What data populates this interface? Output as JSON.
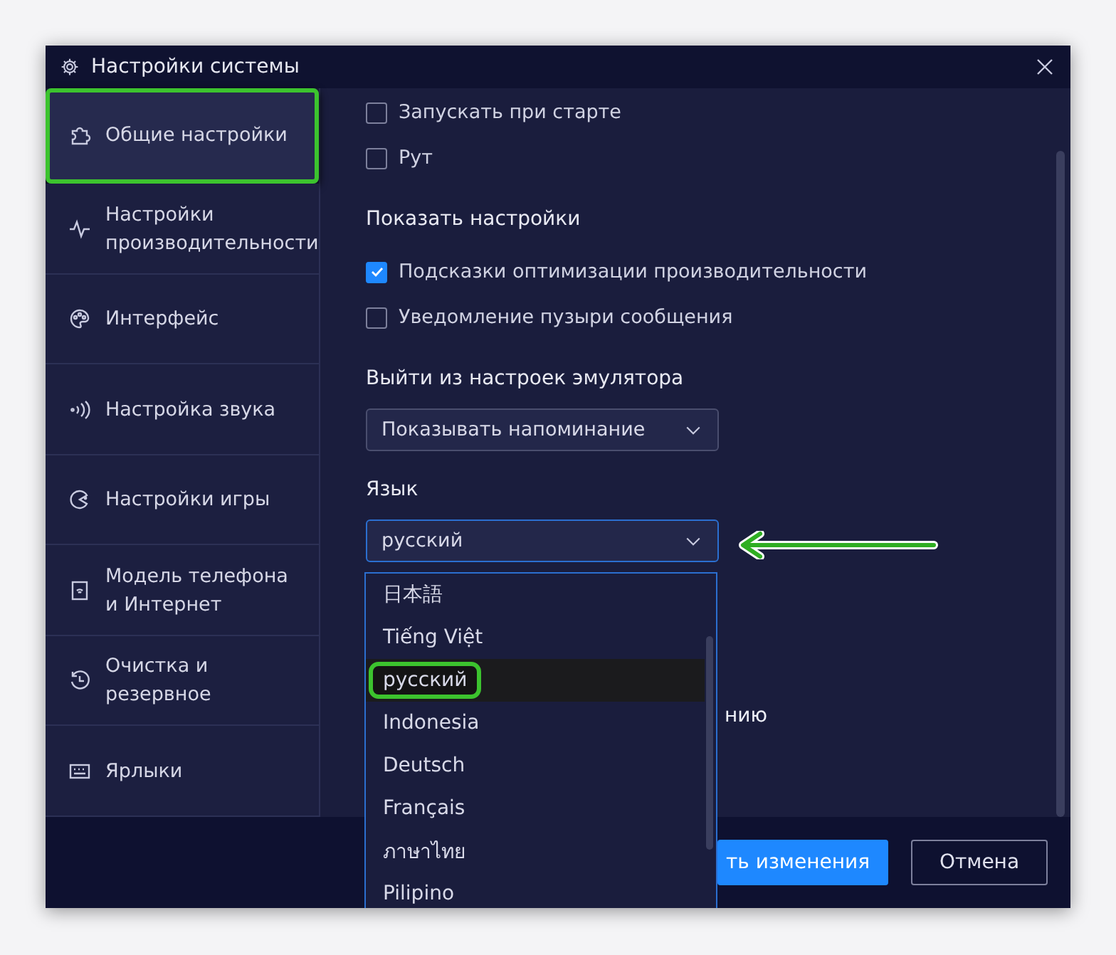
{
  "window": {
    "title": "Настройки системы"
  },
  "sidebar": {
    "items": [
      {
        "label": "Общие настройки",
        "selected": true,
        "highlighted": true
      },
      {
        "label": "Настройки производительности",
        "selected": false,
        "highlighted": false
      },
      {
        "label": "Интерфейс",
        "selected": false,
        "highlighted": false
      },
      {
        "label": "Настройка звука",
        "selected": false,
        "highlighted": false
      },
      {
        "label": "Настройки игры",
        "selected": false,
        "highlighted": false
      },
      {
        "label": "Модель телефона и Интернет",
        "selected": false,
        "highlighted": false
      },
      {
        "label": "Очистка и резервное",
        "selected": false,
        "highlighted": false
      },
      {
        "label": "Ярлыки",
        "selected": false,
        "highlighted": false
      }
    ]
  },
  "content": {
    "items": [
      {
        "kind": "checkbox",
        "label": "Запускать при старте",
        "checked": false
      },
      {
        "kind": "checkbox",
        "label": "Рут",
        "checked": false
      },
      {
        "kind": "heading",
        "label": "Показать настройки"
      },
      {
        "kind": "checkbox",
        "label": "Подсказки оптимизации производительности",
        "checked": true
      },
      {
        "kind": "checkbox",
        "label": "Уведомление пузыри сообщения",
        "checked": false
      },
      {
        "kind": "heading",
        "label": "Выйти из настроек эмулятора"
      },
      {
        "kind": "select",
        "value": "Показывать напоминание",
        "open": false
      },
      {
        "kind": "heading",
        "label": "Язык"
      },
      {
        "kind": "select",
        "value": "русский",
        "open": true
      },
      {
        "kind": "partial",
        "label": "нию"
      }
    ]
  },
  "language_list": {
    "options": [
      {
        "label": "日本語",
        "selected": false,
        "highlighted": false
      },
      {
        "label": "Tiếng Việt",
        "selected": false,
        "highlighted": false
      },
      {
        "label": "русский",
        "selected": true,
        "highlighted": true
      },
      {
        "label": "Indonesia",
        "selected": false,
        "highlighted": false
      },
      {
        "label": "Deutsch",
        "selected": false,
        "highlighted": false
      },
      {
        "label": "Français",
        "selected": false,
        "highlighted": false
      },
      {
        "label": "ภาษาไทย",
        "selected": false,
        "highlighted": false
      },
      {
        "label": "Pilipino",
        "selected": false,
        "highlighted": false
      }
    ]
  },
  "footer": {
    "buttons": [
      {
        "label": "ть изменения",
        "kind": "primary"
      },
      {
        "label": "Отмена",
        "kind": "secondary"
      }
    ]
  }
}
